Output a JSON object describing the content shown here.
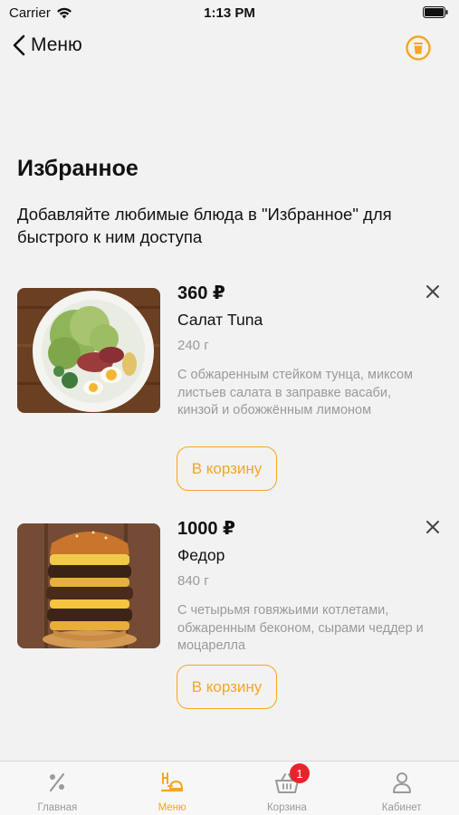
{
  "status_bar": {
    "carrier": "Carrier",
    "time": "1:13 PM"
  },
  "nav": {
    "back_label": "Меню",
    "accent_color": "#f5a623"
  },
  "page": {
    "title": "Избранное",
    "subtitle": "Добавляйте любимые блюда в \"Избранное\" для быстрого к ним доступа"
  },
  "items": [
    {
      "price": "360 ₽",
      "name": "Салат Tuna",
      "weight": "240 г",
      "description": "С обжаренным стейком тунца, миксом листьев салата в заправке васаби, кинзой и обожжённым лимоном",
      "cart_label": "В корзину"
    },
    {
      "price": "1000 ₽",
      "name": "Федор",
      "weight": "840 г",
      "description": "С четырьмя говяжьими котлетами, обжаренным беконом, сырами чеддер и моцарелла",
      "cart_label": "В корзину"
    }
  ],
  "tabs": [
    {
      "label": "Главная",
      "icon": "percent-icon",
      "active": false
    },
    {
      "label": "Меню",
      "icon": "menu-food-icon",
      "active": true
    },
    {
      "label": "Корзина",
      "icon": "basket-icon",
      "active": false,
      "badge": "1"
    },
    {
      "label": "Кабинет",
      "icon": "user-icon",
      "active": false
    }
  ]
}
